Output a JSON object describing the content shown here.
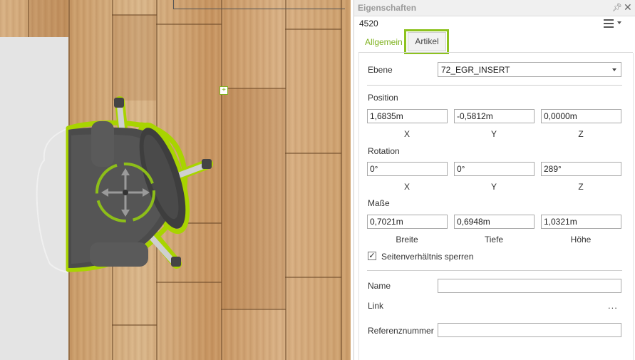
{
  "panel": {
    "title": "Eigenschaften",
    "object_id": "4520",
    "icons": {
      "pin": "pin-icon",
      "close": "close-icon",
      "menu": "hamburger-menu-icon"
    }
  },
  "tabs": [
    {
      "label": "Allgemein",
      "active": true
    },
    {
      "label": "Artikel",
      "active": false
    }
  ],
  "ebene": {
    "label": "Ebene",
    "value": "72_EGR_INSERT"
  },
  "position": {
    "label": "Position",
    "x": "1,6835m",
    "y": "-0,5812m",
    "z": "0,0000m",
    "x_label": "X",
    "y_label": "Y",
    "z_label": "Z"
  },
  "rotation": {
    "label": "Rotation",
    "x": "0°",
    "y": "0°",
    "z": "289°",
    "x_label": "X",
    "y_label": "Y",
    "z_label": "Z"
  },
  "masse": {
    "label": "Maße",
    "breite": "0,7021m",
    "tiefe": "0,6948m",
    "hoehe": "1,0321m",
    "breite_label": "Breite",
    "tiefe_label": "Tiefe",
    "hoehe_label": "Höhe"
  },
  "lock_ratio": {
    "label": "Seitenverhältnis sperren",
    "checked": true
  },
  "name": {
    "label": "Name",
    "value": ""
  },
  "link": {
    "label": "Link",
    "more": "..."
  },
  "referenz": {
    "label": "Referenznummer",
    "value": ""
  },
  "colors": {
    "accent": "#8dc21f",
    "tab_active_text": "#7fb21f"
  }
}
